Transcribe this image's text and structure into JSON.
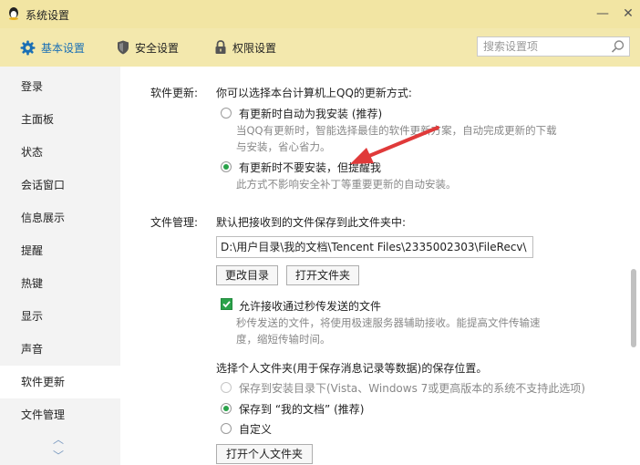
{
  "window": {
    "title": "系统设置",
    "minimize": "—",
    "close": "✕"
  },
  "tabs": [
    {
      "label": "基本设置",
      "icon": "gear-icon",
      "active": true
    },
    {
      "label": "安全设置",
      "icon": "shield-icon",
      "active": false
    },
    {
      "label": "权限设置",
      "icon": "lock-icon",
      "active": false
    }
  ],
  "search": {
    "placeholder": "搜索设置项"
  },
  "sidebar": {
    "items": [
      {
        "label": "登录"
      },
      {
        "label": "主面板"
      },
      {
        "label": "状态"
      },
      {
        "label": "会话窗口"
      },
      {
        "label": "信息展示"
      },
      {
        "label": "提醒"
      },
      {
        "label": "热键"
      },
      {
        "label": "显示"
      },
      {
        "label": "声音"
      },
      {
        "label": "软件更新",
        "active": true
      },
      {
        "label": "文件管理"
      }
    ],
    "scroll_up": "︿",
    "scroll_down": "﹀"
  },
  "software_update": {
    "section_label": "软件更新:",
    "intro": "你可以选择本台计算机上QQ的更新方式:",
    "options": [
      {
        "label": "有更新时自动为我安装 (推荐)",
        "selected": false,
        "desc_line1": "当QQ有更新时，智能选择最佳的软件更新方案，自动完成更新的下载",
        "desc_line2": "与安装，省心省力。"
      },
      {
        "label": "有更新时不要安装，但提醒我",
        "selected": true,
        "desc_line1": "此方式不影响安全补丁等重要更新的自动安装。"
      }
    ]
  },
  "file_management": {
    "section_label": "文件管理:",
    "intro": "默认把接收到的文件保存到此文件夹中:",
    "path": "D:\\用户目录\\我的文档\\Tencent Files\\2335002303\\FileRecv\\",
    "change_dir_button": "更改目录",
    "open_folder_button": "打开文件夹",
    "allow_flash_transfer": {
      "label": "允许接收通过秒传发送的文件",
      "checked": true,
      "desc_line1": "秒传发送的文件，将使用极速服务器辅助接收。能提高文件传输速",
      "desc_line2": "度，缩短传输时间。"
    },
    "personal_folder": {
      "intro": "选择个人文件夹(用于保存消息记录等数据)的保存位置。",
      "options": [
        {
          "label": "保存到安装目录下(Vista、Windows 7或更高版本的系统不支持此选项)",
          "selected": false,
          "disabled": true
        },
        {
          "label": "保存到 “我的文档” (推荐)",
          "selected": true,
          "disabled": false
        },
        {
          "label": "自定义",
          "selected": false,
          "disabled": false
        }
      ],
      "open_personal_folder_button": "打开个人文件夹"
    }
  },
  "colors": {
    "accent_green": "#2aa24a",
    "arrow_red": "#e03a3a",
    "titlebar": "#f2e5a3",
    "tab_active": "#1a6fb5"
  }
}
